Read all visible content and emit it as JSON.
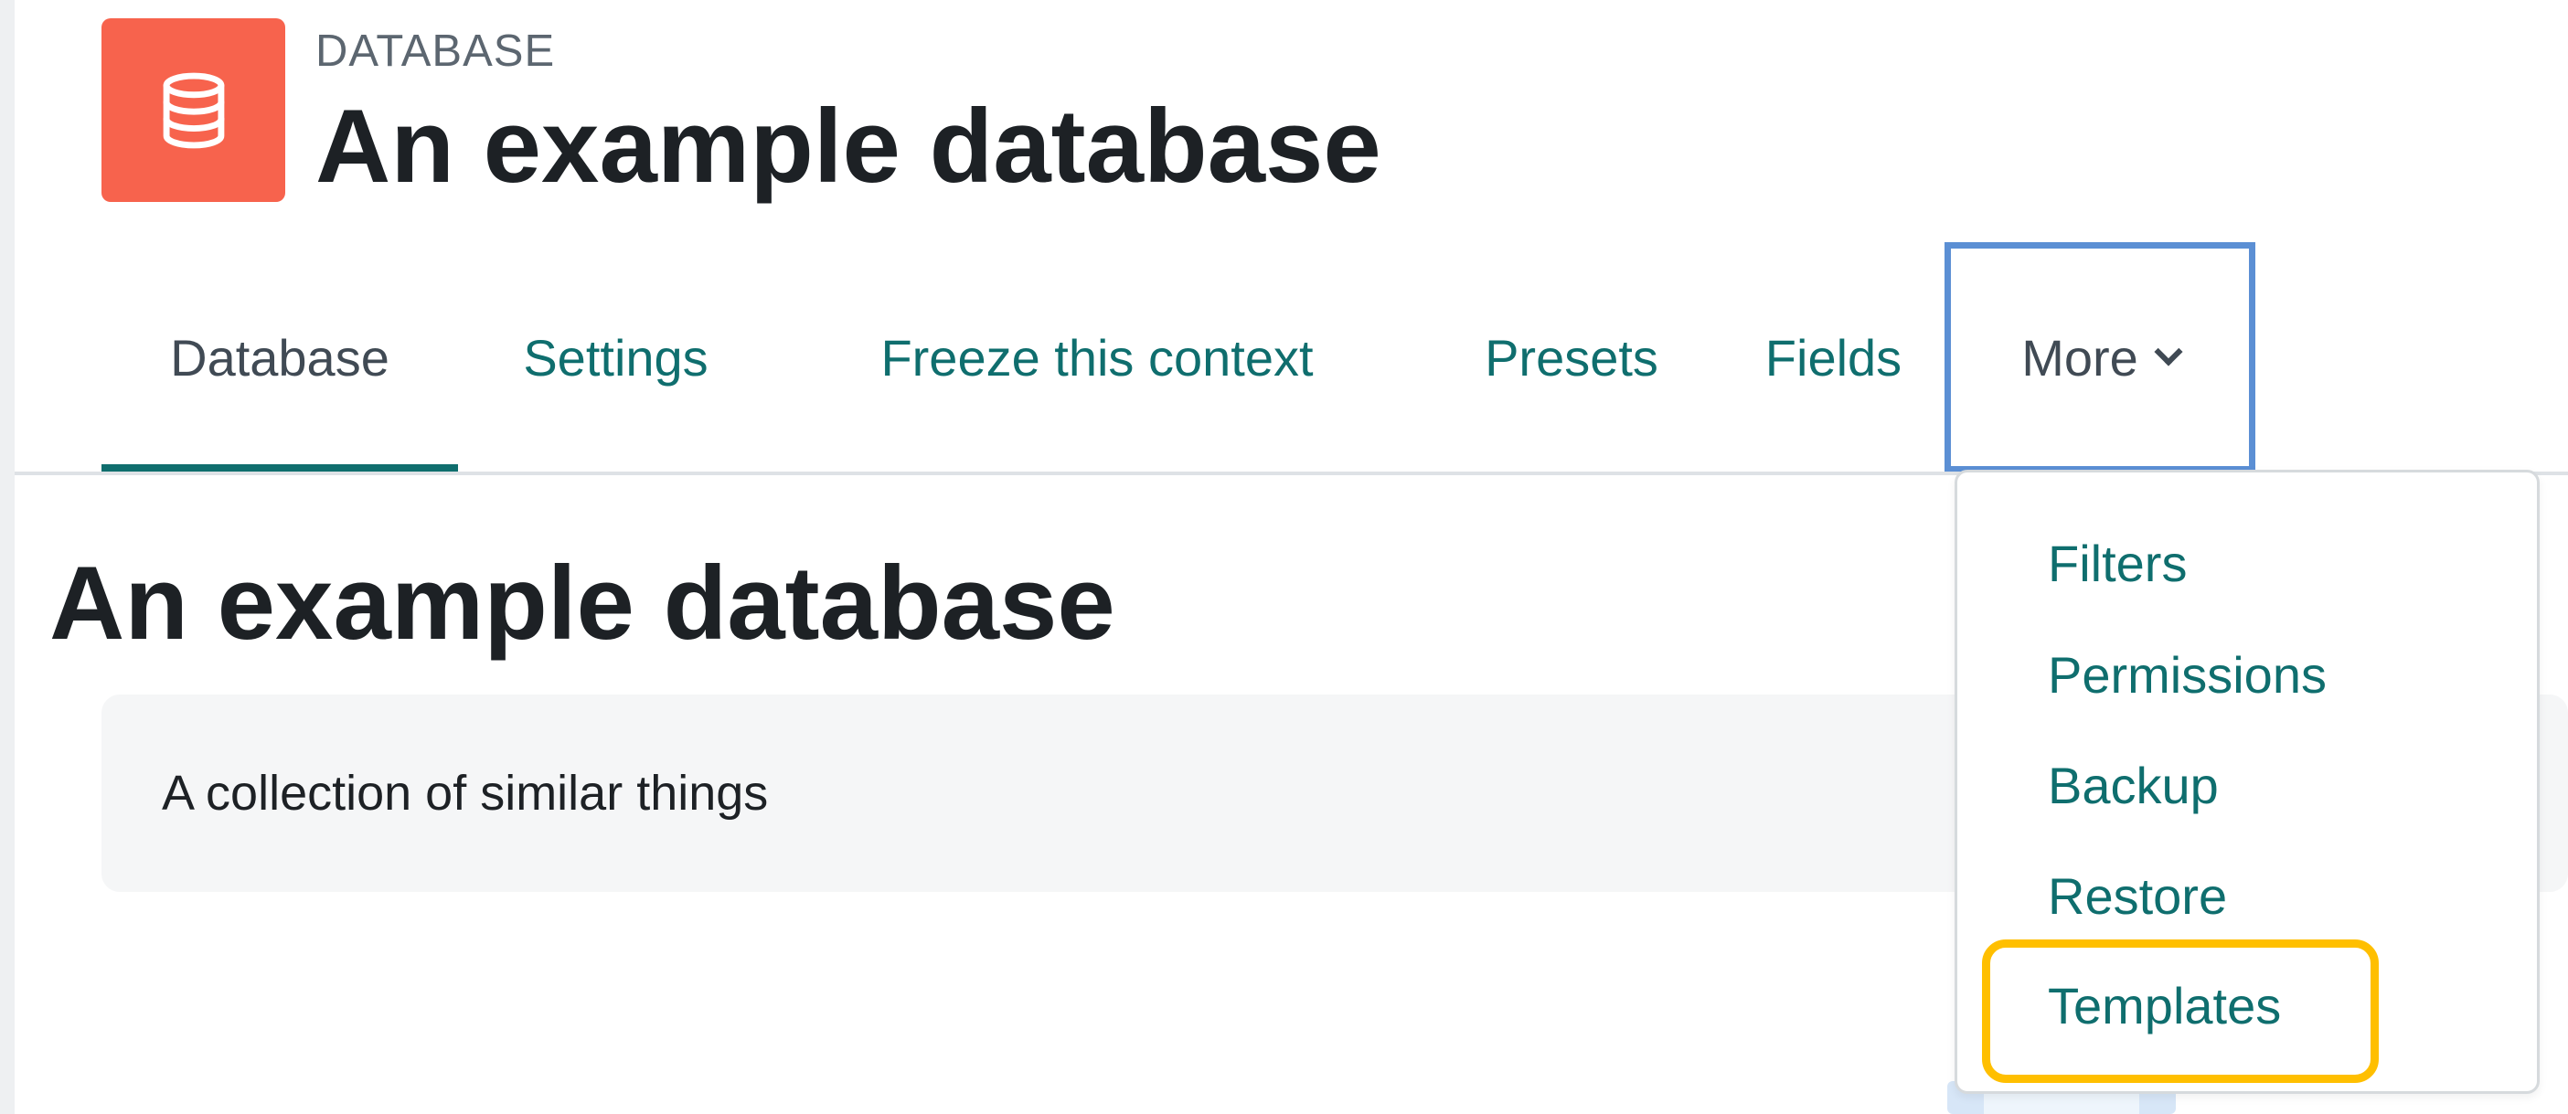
{
  "header": {
    "module_type": "DATABASE",
    "title": "An example database",
    "icon": "database-icon",
    "icon_color": "#f7634d"
  },
  "nav": {
    "tabs": [
      {
        "label": "Database",
        "active": true
      },
      {
        "label": "Settings",
        "active": false
      },
      {
        "label": "Freeze this context",
        "active": false
      },
      {
        "label": "Presets",
        "active": false
      },
      {
        "label": "Fields",
        "active": false
      }
    ],
    "more": {
      "label": "More",
      "icon": "chevron-down-icon",
      "expanded": true
    },
    "accent_color": "#0f6e6e"
  },
  "main": {
    "heading": "An example database",
    "intro": "A collection of similar things"
  },
  "more_menu": {
    "items": [
      {
        "label": "Filters"
      },
      {
        "label": "Permissions"
      },
      {
        "label": "Backup"
      },
      {
        "label": "Restore"
      },
      {
        "label": "Templates",
        "highlighted": true
      }
    ],
    "highlight_color": "#ffbf00"
  }
}
